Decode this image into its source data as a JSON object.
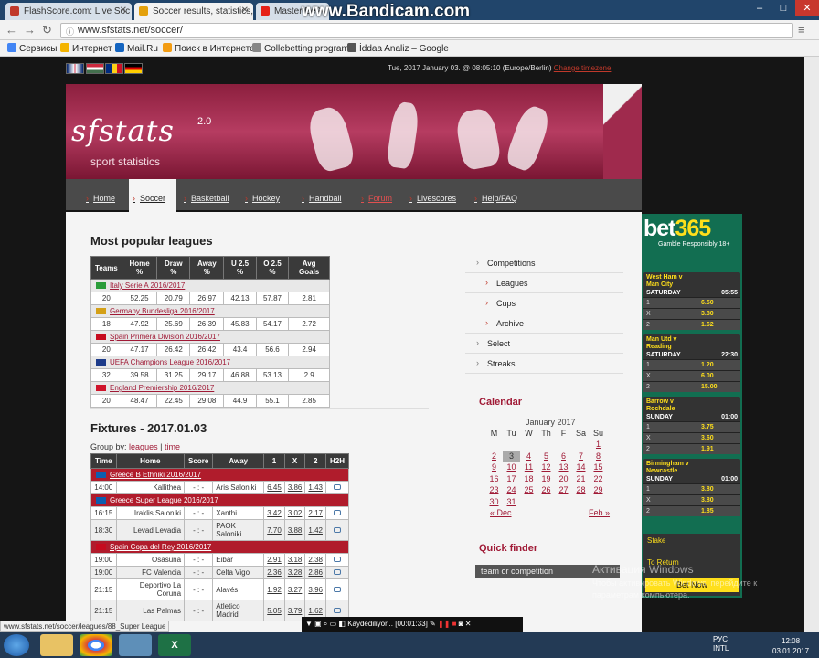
{
  "browser": {
    "tabs": [
      {
        "title": "FlashScore.com: Live Soc",
        "color": "#c0392b"
      },
      {
        "title": "Soccer results, statistics,",
        "color": "#e4a10c"
      },
      {
        "title": "Master Be",
        "color": "#e62117"
      }
    ],
    "watermark": "www.Bandicam.com",
    "url": "www.sfstats.net/soccer/",
    "bookmarks": [
      "Сервисы",
      "Интернет",
      "Mail.Ru",
      "Поиск в Интернете",
      "Collebetting program",
      "İddaa Analiz – Google"
    ],
    "status_url": "www.sfstats.net/soccer/leagues/88_Super League"
  },
  "site": {
    "datetime": "Tue, 2017 January 03. @ 08:05:10 (Europe/Berlin)",
    "change_timezone": "Change timezone",
    "logo": "sfstats",
    "logo_version": "2.0",
    "tagline": "sport statistics",
    "menu": [
      "Home",
      "Soccer",
      "Basketball",
      "Hockey",
      "Handball",
      "Forum",
      "Livescores",
      "Help/FAQ"
    ]
  },
  "popular": {
    "title": "Most popular leagues",
    "headers": [
      "Teams",
      "Home %",
      "Draw %",
      "Away %",
      "U 2.5 %",
      "O 2.5 %",
      "Avg Goals"
    ],
    "leagues": [
      {
        "name": "Italy Serie A 2016/2017",
        "flag": "#2a9d3a",
        "row": [
          "20",
          "52.25",
          "20.79",
          "26.97",
          "42.13",
          "57.87",
          "2.81"
        ]
      },
      {
        "name": "Germany Bundesliga 2016/2017",
        "flag": "#d4a017",
        "row": [
          "18",
          "47.92",
          "25.69",
          "26.39",
          "45.83",
          "54.17",
          "2.72"
        ]
      },
      {
        "name": "Spain Primera Division 2016/2017",
        "flag": "#c60b1e",
        "row": [
          "20",
          "47.17",
          "26.42",
          "26.42",
          "43.4",
          "56.6",
          "2.94"
        ]
      },
      {
        "name": "UEFA Champions League 2016/2017",
        "flag": "#1d3b8a",
        "row": [
          "32",
          "39.58",
          "31.25",
          "29.17",
          "46.88",
          "53.13",
          "2.9"
        ]
      },
      {
        "name": "England Premiership 2016/2017",
        "flag": "#cf142b",
        "row": [
          "20",
          "48.47",
          "22.45",
          "29.08",
          "44.9",
          "55.1",
          "2.85"
        ]
      }
    ]
  },
  "fixtures": {
    "title": "Fixtures - 2017.01.03",
    "group_by": "Group by:",
    "group_leagues": "leagues",
    "group_sep": "|",
    "group_time": "time",
    "headers": [
      "Time",
      "Home",
      "Score",
      "Away",
      "1",
      "X",
      "2",
      "H2H"
    ],
    "groups": [
      {
        "league": "Greece B Ethniki 2016/2017",
        "matches": [
          {
            "time": "14:00",
            "home": "Kallithea",
            "score": "- : -",
            "away": "Aris Saloniki",
            "o1": "6.45",
            "ox": "3.86",
            "o2": "1.43"
          }
        ]
      },
      {
        "league": "Greece Super League 2016/2017",
        "matches": [
          {
            "time": "16:15",
            "home": "Iraklis Saloniki",
            "score": "- : -",
            "away": "Xanthi",
            "o1": "3.42",
            "ox": "3.02",
            "o2": "2.17"
          },
          {
            "time": "18:30",
            "home": "Levad Levadia",
            "score": "- : -",
            "away": "PAOK Saloniki",
            "o1": "7.70",
            "ox": "3.88",
            "o2": "1.42"
          }
        ]
      },
      {
        "league": "Spain Copa del Rey 2016/2017",
        "matches": [
          {
            "time": "19:00",
            "home": "Osasuna",
            "score": "- : -",
            "away": "Eibar",
            "o1": "2.91",
            "ox": "3.18",
            "o2": "2.38"
          },
          {
            "time": "19:00",
            "home": "FC Valencia",
            "score": "- : -",
            "away": "Celta Vigo",
            "o1": "2.36",
            "ox": "3.28",
            "o2": "2.86"
          },
          {
            "time": "21:15",
            "home": "Deportivo La Coruna",
            "score": "- : -",
            "away": "Alavés",
            "o1": "1.92",
            "ox": "3.27",
            "o2": "3.96"
          },
          {
            "time": "21:15",
            "home": "Las Palmas",
            "score": "- : -",
            "away": "Atletico Madrid",
            "o1": "5.05",
            "ox": "3.79",
            "o2": "1.62"
          }
        ]
      }
    ]
  },
  "sidebar": {
    "competitions": "Competitions",
    "leagues": "Leagues",
    "cups": "Cups",
    "archive": "Archive",
    "select": "Select",
    "streaks": "Streaks"
  },
  "calendar": {
    "title": "Calendar",
    "month": "January 2017",
    "weekdays": [
      "M",
      "Tu",
      "W",
      "Th",
      "F",
      "Sa",
      "Su"
    ],
    "weeks": [
      [
        "",
        "",
        "",
        "",
        "",
        "",
        "1"
      ],
      [
        "2",
        "3",
        "4",
        "5",
        "6",
        "7",
        "8"
      ],
      [
        "9",
        "10",
        "11",
        "12",
        "13",
        "14",
        "15"
      ],
      [
        "16",
        "17",
        "18",
        "19",
        "20",
        "21",
        "22"
      ],
      [
        "23",
        "24",
        "25",
        "26",
        "27",
        "28",
        "29"
      ],
      [
        "30",
        "31",
        "",
        "",
        "",
        "",
        ""
      ]
    ],
    "today": "3",
    "prev": "« Dec",
    "next": "Feb »"
  },
  "quickfinder": {
    "title": "Quick finder",
    "placeholder": "team or competition"
  },
  "bet365": {
    "logo_a": "bet",
    "logo_b": "365",
    "sub": "Gamble Responsibly 18+",
    "matches": [
      {
        "teams": "West Ham v\nMan City",
        "day": "SATURDAY",
        "time": "05:55",
        "odds": [
          [
            "1",
            "6.50"
          ],
          [
            "X",
            "3.80"
          ],
          [
            "2",
            "1.62"
          ]
        ]
      },
      {
        "teams": "Man Utd v\nReading",
        "day": "SATURDAY",
        "time": "22:30",
        "odds": [
          [
            "1",
            "1.20"
          ],
          [
            "X",
            "6.00"
          ],
          [
            "2",
            "15.00"
          ]
        ]
      },
      {
        "teams": "Barrow v\nRochdale",
        "day": "SUNDAY",
        "time": "01:00",
        "odds": [
          [
            "1",
            "3.75"
          ],
          [
            "X",
            "3.60"
          ],
          [
            "2",
            "1.91"
          ]
        ]
      },
      {
        "teams": "Birmingham v\nNewcastle",
        "day": "SUNDAY",
        "time": "01:00",
        "odds": [
          [
            "1",
            "3.80"
          ],
          [
            "X",
            "3.80"
          ],
          [
            "2",
            "1.85"
          ]
        ]
      }
    ],
    "stake": "Stake",
    "to_return": "To Return",
    "bet_now": "Bet Now"
  },
  "overlay": {
    "activation_title": "Активация Windows",
    "activation_text": "Чтобы активировать Windows, перейдите к параметрам компьютера.",
    "bandicam_status": "Kaydediliyor... [00:01:33]"
  },
  "taskbar": {
    "lang": "РУС",
    "layout": "INTL",
    "time": "12:08",
    "date": "03.01.2017"
  }
}
